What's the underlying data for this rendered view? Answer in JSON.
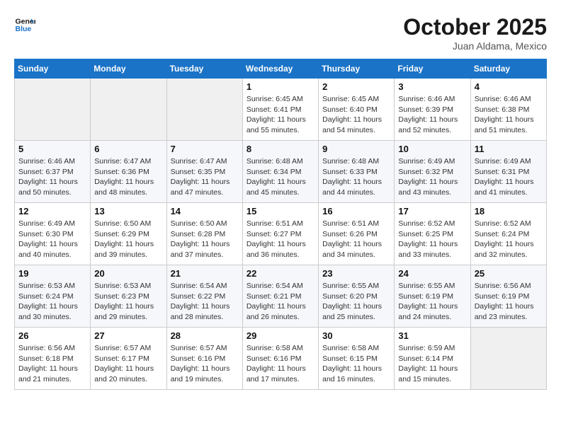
{
  "header": {
    "logo_line1": "General",
    "logo_line2": "Blue",
    "month": "October 2025",
    "location": "Juan Aldama, Mexico"
  },
  "weekdays": [
    "Sunday",
    "Monday",
    "Tuesday",
    "Wednesday",
    "Thursday",
    "Friday",
    "Saturday"
  ],
  "weeks": [
    [
      {
        "day": "",
        "sunrise": "",
        "sunset": "",
        "daylight": ""
      },
      {
        "day": "",
        "sunrise": "",
        "sunset": "",
        "daylight": ""
      },
      {
        "day": "",
        "sunrise": "",
        "sunset": "",
        "daylight": ""
      },
      {
        "day": "1",
        "sunrise": "Sunrise: 6:45 AM",
        "sunset": "Sunset: 6:41 PM",
        "daylight": "Daylight: 11 hours and 55 minutes."
      },
      {
        "day": "2",
        "sunrise": "Sunrise: 6:45 AM",
        "sunset": "Sunset: 6:40 PM",
        "daylight": "Daylight: 11 hours and 54 minutes."
      },
      {
        "day": "3",
        "sunrise": "Sunrise: 6:46 AM",
        "sunset": "Sunset: 6:39 PM",
        "daylight": "Daylight: 11 hours and 52 minutes."
      },
      {
        "day": "4",
        "sunrise": "Sunrise: 6:46 AM",
        "sunset": "Sunset: 6:38 PM",
        "daylight": "Daylight: 11 hours and 51 minutes."
      }
    ],
    [
      {
        "day": "5",
        "sunrise": "Sunrise: 6:46 AM",
        "sunset": "Sunset: 6:37 PM",
        "daylight": "Daylight: 11 hours and 50 minutes."
      },
      {
        "day": "6",
        "sunrise": "Sunrise: 6:47 AM",
        "sunset": "Sunset: 6:36 PM",
        "daylight": "Daylight: 11 hours and 48 minutes."
      },
      {
        "day": "7",
        "sunrise": "Sunrise: 6:47 AM",
        "sunset": "Sunset: 6:35 PM",
        "daylight": "Daylight: 11 hours and 47 minutes."
      },
      {
        "day": "8",
        "sunrise": "Sunrise: 6:48 AM",
        "sunset": "Sunset: 6:34 PM",
        "daylight": "Daylight: 11 hours and 45 minutes."
      },
      {
        "day": "9",
        "sunrise": "Sunrise: 6:48 AM",
        "sunset": "Sunset: 6:33 PM",
        "daylight": "Daylight: 11 hours and 44 minutes."
      },
      {
        "day": "10",
        "sunrise": "Sunrise: 6:49 AM",
        "sunset": "Sunset: 6:32 PM",
        "daylight": "Daylight: 11 hours and 43 minutes."
      },
      {
        "day": "11",
        "sunrise": "Sunrise: 6:49 AM",
        "sunset": "Sunset: 6:31 PM",
        "daylight": "Daylight: 11 hours and 41 minutes."
      }
    ],
    [
      {
        "day": "12",
        "sunrise": "Sunrise: 6:49 AM",
        "sunset": "Sunset: 6:30 PM",
        "daylight": "Daylight: 11 hours and 40 minutes."
      },
      {
        "day": "13",
        "sunrise": "Sunrise: 6:50 AM",
        "sunset": "Sunset: 6:29 PM",
        "daylight": "Daylight: 11 hours and 39 minutes."
      },
      {
        "day": "14",
        "sunrise": "Sunrise: 6:50 AM",
        "sunset": "Sunset: 6:28 PM",
        "daylight": "Daylight: 11 hours and 37 minutes."
      },
      {
        "day": "15",
        "sunrise": "Sunrise: 6:51 AM",
        "sunset": "Sunset: 6:27 PM",
        "daylight": "Daylight: 11 hours and 36 minutes."
      },
      {
        "day": "16",
        "sunrise": "Sunrise: 6:51 AM",
        "sunset": "Sunset: 6:26 PM",
        "daylight": "Daylight: 11 hours and 34 minutes."
      },
      {
        "day": "17",
        "sunrise": "Sunrise: 6:52 AM",
        "sunset": "Sunset: 6:25 PM",
        "daylight": "Daylight: 11 hours and 33 minutes."
      },
      {
        "day": "18",
        "sunrise": "Sunrise: 6:52 AM",
        "sunset": "Sunset: 6:24 PM",
        "daylight": "Daylight: 11 hours and 32 minutes."
      }
    ],
    [
      {
        "day": "19",
        "sunrise": "Sunrise: 6:53 AM",
        "sunset": "Sunset: 6:24 PM",
        "daylight": "Daylight: 11 hours and 30 minutes."
      },
      {
        "day": "20",
        "sunrise": "Sunrise: 6:53 AM",
        "sunset": "Sunset: 6:23 PM",
        "daylight": "Daylight: 11 hours and 29 minutes."
      },
      {
        "day": "21",
        "sunrise": "Sunrise: 6:54 AM",
        "sunset": "Sunset: 6:22 PM",
        "daylight": "Daylight: 11 hours and 28 minutes."
      },
      {
        "day": "22",
        "sunrise": "Sunrise: 6:54 AM",
        "sunset": "Sunset: 6:21 PM",
        "daylight": "Daylight: 11 hours and 26 minutes."
      },
      {
        "day": "23",
        "sunrise": "Sunrise: 6:55 AM",
        "sunset": "Sunset: 6:20 PM",
        "daylight": "Daylight: 11 hours and 25 minutes."
      },
      {
        "day": "24",
        "sunrise": "Sunrise: 6:55 AM",
        "sunset": "Sunset: 6:19 PM",
        "daylight": "Daylight: 11 hours and 24 minutes."
      },
      {
        "day": "25",
        "sunrise": "Sunrise: 6:56 AM",
        "sunset": "Sunset: 6:19 PM",
        "daylight": "Daylight: 11 hours and 23 minutes."
      }
    ],
    [
      {
        "day": "26",
        "sunrise": "Sunrise: 6:56 AM",
        "sunset": "Sunset: 6:18 PM",
        "daylight": "Daylight: 11 hours and 21 minutes."
      },
      {
        "day": "27",
        "sunrise": "Sunrise: 6:57 AM",
        "sunset": "Sunset: 6:17 PM",
        "daylight": "Daylight: 11 hours and 20 minutes."
      },
      {
        "day": "28",
        "sunrise": "Sunrise: 6:57 AM",
        "sunset": "Sunset: 6:16 PM",
        "daylight": "Daylight: 11 hours and 19 minutes."
      },
      {
        "day": "29",
        "sunrise": "Sunrise: 6:58 AM",
        "sunset": "Sunset: 6:16 PM",
        "daylight": "Daylight: 11 hours and 17 minutes."
      },
      {
        "day": "30",
        "sunrise": "Sunrise: 6:58 AM",
        "sunset": "Sunset: 6:15 PM",
        "daylight": "Daylight: 11 hours and 16 minutes."
      },
      {
        "day": "31",
        "sunrise": "Sunrise: 6:59 AM",
        "sunset": "Sunset: 6:14 PM",
        "daylight": "Daylight: 11 hours and 15 minutes."
      },
      {
        "day": "",
        "sunrise": "",
        "sunset": "",
        "daylight": ""
      }
    ]
  ]
}
